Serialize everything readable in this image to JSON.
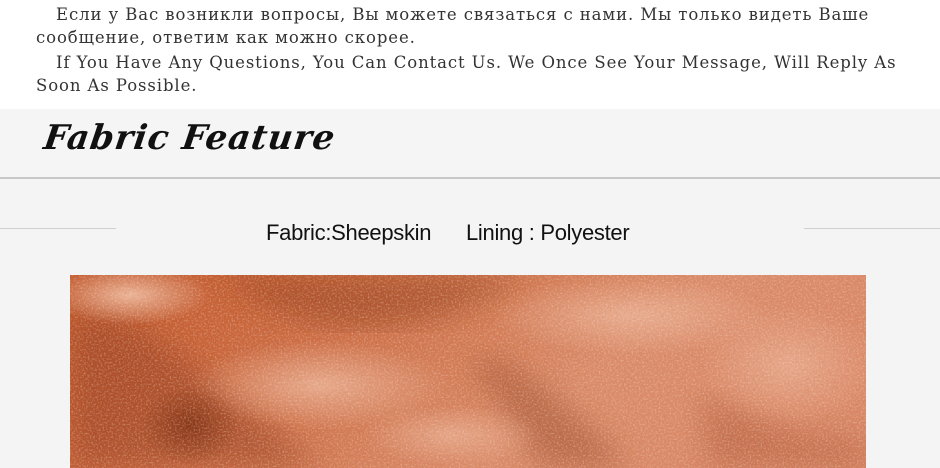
{
  "notice": {
    "ru_text": "Если у Вас возникли вопросы, Вы можете связаться с нами. Мы только видеть Ваше сообщение, ответим как можно скорее.",
    "en_text": "If You Have Any Questions, You Can Contact Us. We Once See Your Message, Will Reply As Soon As Possible."
  },
  "feature": {
    "title": "Fabric Feature"
  },
  "specs": {
    "fabric": "Fabric:Sheepskin",
    "lining": "Lining : Polyester"
  },
  "colors": {
    "leather_base": "#c8643a",
    "leather_highlight": "#e8a585",
    "leather_shadow": "#8c3a18"
  }
}
